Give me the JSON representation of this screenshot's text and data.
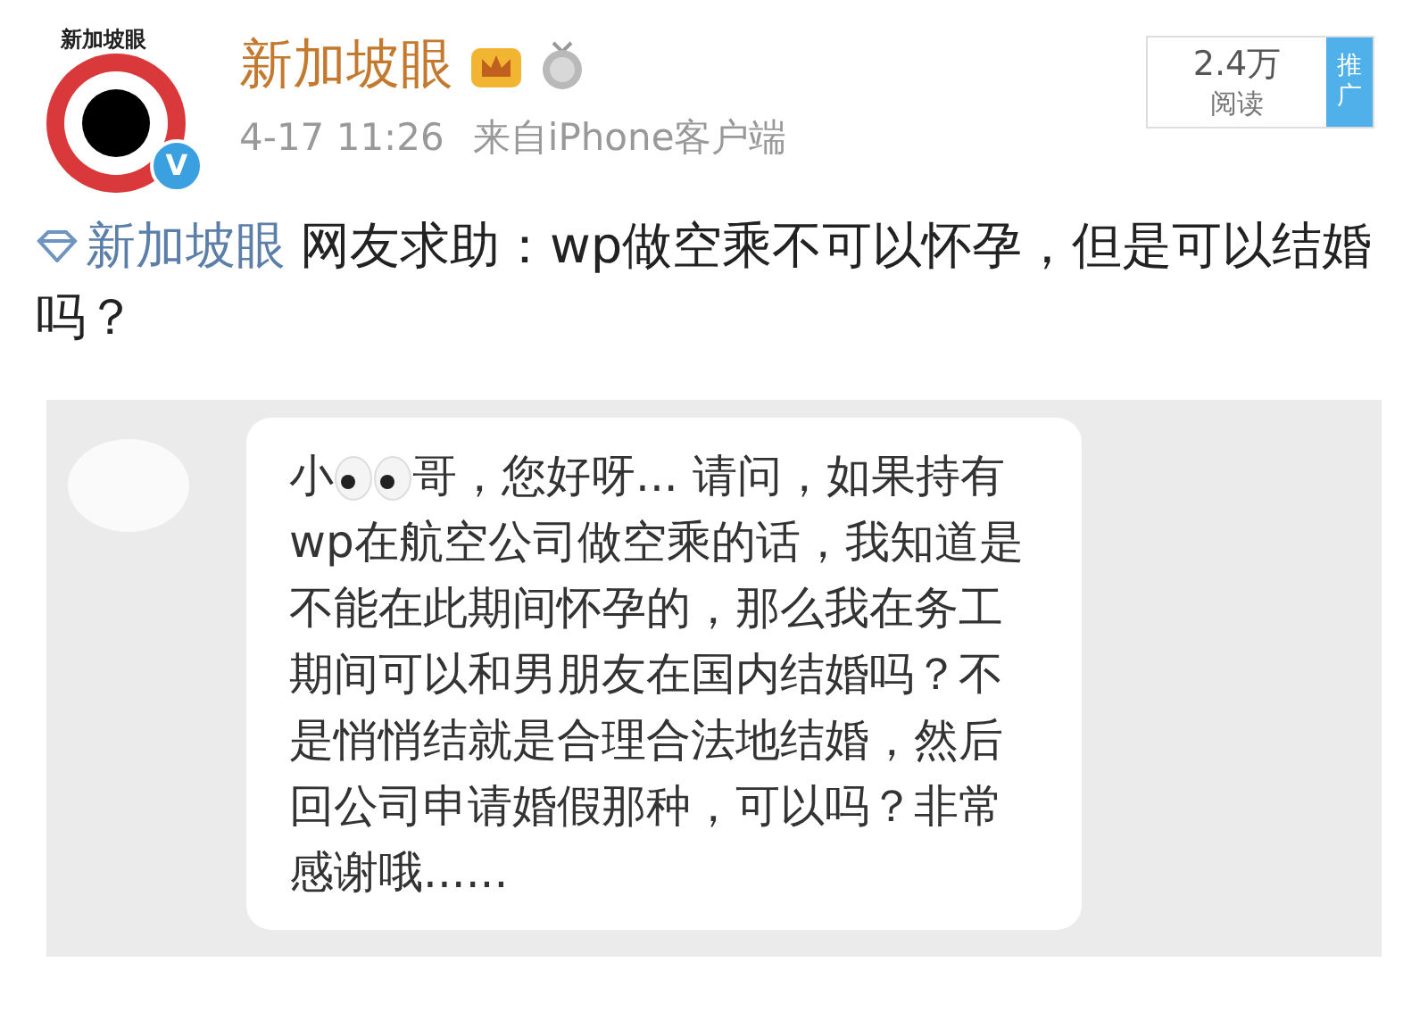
{
  "post_header": {
    "avatar_label": "新加坡眼",
    "verified_badge": "V",
    "author": "新加坡眼",
    "timestamp": "4-17 11:26",
    "source": "来自iPhone客户端"
  },
  "reads": {
    "count": "2.4万",
    "label": "阅读",
    "promote": "推广"
  },
  "post": {
    "mention": "新加坡眼",
    "text": "网友求助：wp做空乘不可以怀孕，但是可以结婚吗？"
  },
  "message": {
    "before_emoji": "小",
    "after_emoji": "哥，您好呀... 请问，如果持有wp在航空公司做空乘的话，我知道是不能在此期间怀孕的，那么我在务工期间可以和男朋友在国内结婚吗？不是悄悄结就是合理合法地结婚，然后回公司申请婚假那种，可以吗？非常感谢哦......"
  }
}
